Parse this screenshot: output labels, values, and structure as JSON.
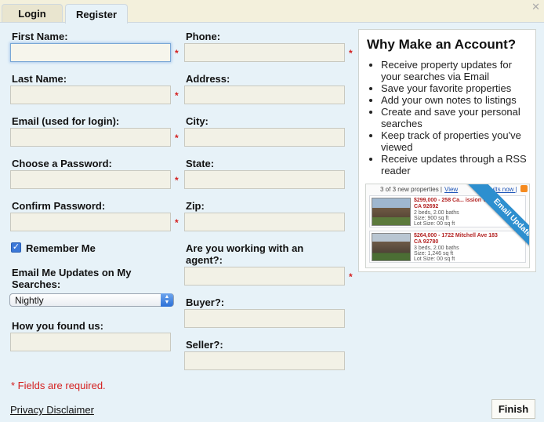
{
  "tabs": {
    "login": "Login",
    "register": "Register"
  },
  "close_glyph": "✕",
  "form": {
    "first_name": {
      "label": "First Name:",
      "value": ""
    },
    "last_name": {
      "label": "Last Name:",
      "value": ""
    },
    "email": {
      "label": "Email (used for login):",
      "value": ""
    },
    "password": {
      "label": "Choose a Password:",
      "value": ""
    },
    "confirm_password": {
      "label": "Confirm Password:",
      "value": ""
    },
    "remember_me": {
      "label": "Remember Me",
      "checked": true
    },
    "email_updates": {
      "label": "Email Me Updates on My Searches:",
      "selected": "Nightly"
    },
    "how_found": {
      "label": "How you found us:",
      "value": ""
    },
    "phone": {
      "label": "Phone:",
      "value": ""
    },
    "address": {
      "label": "Address:",
      "value": ""
    },
    "city": {
      "label": "City:",
      "value": ""
    },
    "state": {
      "label": "State:",
      "value": ""
    },
    "zip": {
      "label": "Zip:",
      "value": ""
    },
    "agent": {
      "label": "Are you working with an agent?:",
      "value": ""
    },
    "buyer": {
      "label": "Buyer?:",
      "value": ""
    },
    "seller": {
      "label": "Seller?:",
      "value": ""
    },
    "required_marker": "*"
  },
  "required_note": "* Fields are required.",
  "privacy_link": "Privacy Disclaimer",
  "finish_label": "Finish",
  "why": {
    "title": "Why Make an Account?",
    "items": [
      "Receive property updates for your searches via Email",
      "Save your favorite properties",
      "Add your own notes to listings",
      "Create and save your personal searches",
      "Keep track of properties you've viewed",
      "Receive updates through a RSS reader"
    ],
    "preview": {
      "count": "3 of 3 new properties |",
      "view": "View",
      "results": "results now |",
      "ribbon": "Email Updates",
      "listings": [
        {
          "title": "$299,000 - 258 Ca... ission Viejo,",
          "line2": "CA 92692",
          "line3": "2 beds, 2.00 baths",
          "line4": "Size: 900 sq ft",
          "line5": "Lot Size: 00 sq ft"
        },
        {
          "title": "$264,000 - 1722 Mitchell Ave 183",
          "line2": "CA 92780",
          "line3": "3 beds, 2.00 baths",
          "line4": "Size: 1,246 sq ft",
          "line5": "Lot Size: 00 sq ft"
        }
      ]
    }
  },
  "colors": {
    "panel": "#e7f2f8",
    "required": "#d42020",
    "ribbon": "#2d8fcf",
    "link": "#1f56b8"
  }
}
